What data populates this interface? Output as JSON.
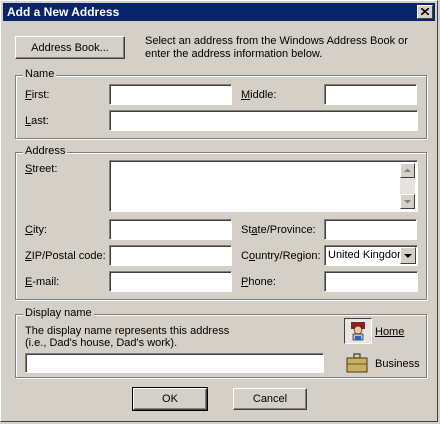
{
  "window": {
    "title": "Add a New Address"
  },
  "top": {
    "address_book_button": "Address Book...",
    "instructions": "Select an address from the Windows Address Book or enter the address information below."
  },
  "name_group": {
    "legend": "Name",
    "first_label": "First:",
    "middle_label": "Middle:",
    "last_label": "Last:",
    "first_value": "",
    "middle_value": "",
    "last_value": ""
  },
  "address_group": {
    "legend": "Address",
    "street_label": "Street:",
    "city_label": "City:",
    "state_label": "State/Province:",
    "zip_label": "ZIP/Postal code:",
    "country_label": "Country/Region:",
    "country_value": "United Kingdom",
    "email_label": "E-mail:",
    "phone_label": "Phone:"
  },
  "display_group": {
    "legend": "Display name",
    "desc_line1": "The display name represents this address",
    "desc_line2": "(i.e., Dad's house, Dad's work).",
    "home_label": "Home",
    "business_label": "Business",
    "selected": "Home"
  },
  "buttons": {
    "ok": "OK",
    "cancel": "Cancel"
  }
}
